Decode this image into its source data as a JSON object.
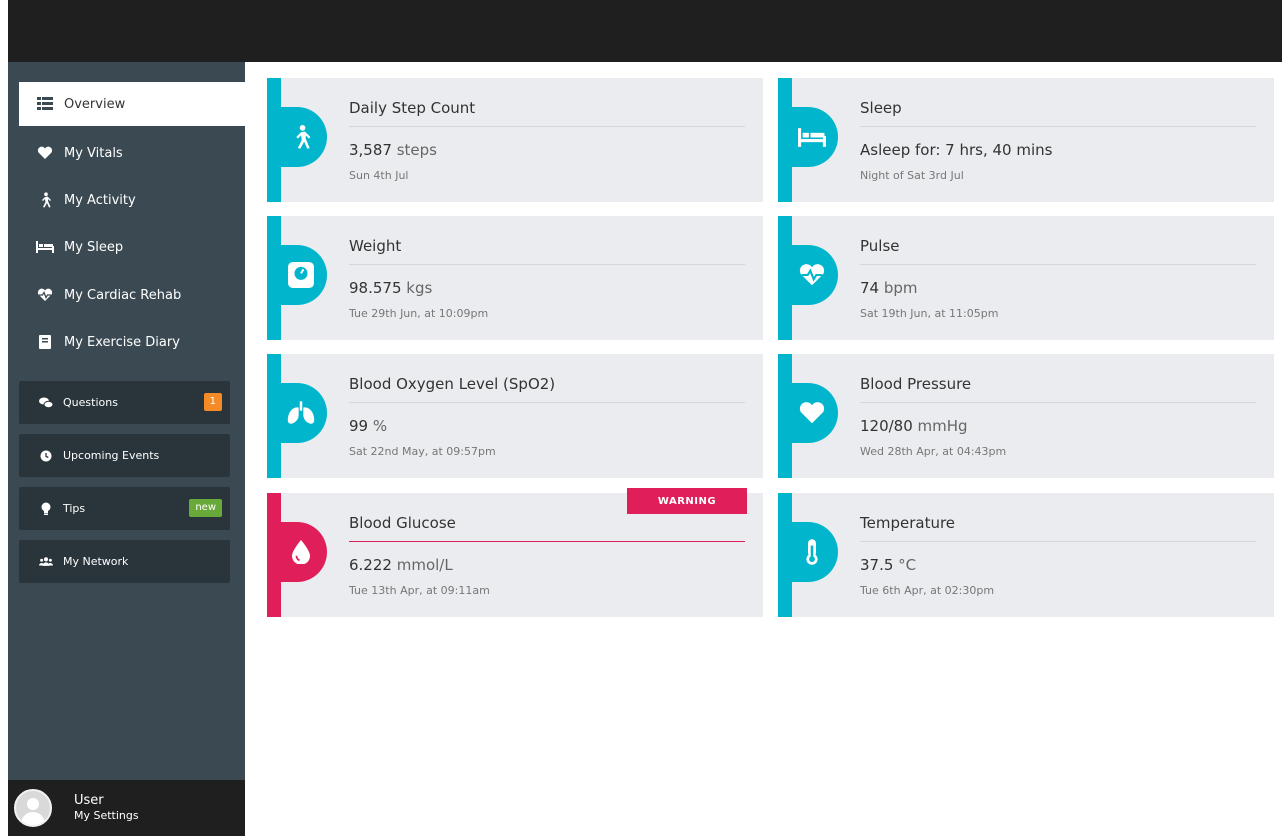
{
  "sidebar": {
    "nav": [
      {
        "label": "Overview",
        "icon": "list-icon"
      },
      {
        "label": "My Vitals",
        "icon": "heart-icon"
      },
      {
        "label": "My Activity",
        "icon": "walking-icon"
      },
      {
        "label": "My Sleep",
        "icon": "bed-icon"
      },
      {
        "label": "My Cardiac Rehab",
        "icon": "heartbeat-icon"
      },
      {
        "label": "My Exercise Diary",
        "icon": "book-icon"
      }
    ],
    "boxes": [
      {
        "label": "Questions",
        "icon": "chat-icon",
        "badge": "1"
      },
      {
        "label": "Upcoming Events",
        "icon": "clock-icon"
      },
      {
        "label": "Tips",
        "icon": "lightbulb-icon",
        "badge": "new"
      },
      {
        "label": "My Network",
        "icon": "users-icon"
      }
    ]
  },
  "user": {
    "name": "User",
    "settings": "My Settings"
  },
  "cards": [
    {
      "title": "Daily Step Count",
      "value": "3,587",
      "unit": " steps",
      "date": "Sun 4th Jul",
      "icon": "walking-icon"
    },
    {
      "title": "Sleep",
      "value": "Asleep for: 7 hrs, 40 mins",
      "unit": "",
      "date": "Night of Sat 3rd Jul",
      "icon": "bed-icon"
    },
    {
      "title": "Weight",
      "value": "98.575",
      "unit": " kgs",
      "date": "Tue 29th Jun, at 10:09pm",
      "icon": "scale-icon"
    },
    {
      "title": "Pulse",
      "value": "74",
      "unit": " bpm",
      "date": "Sat 19th Jun, at 11:05pm",
      "icon": "heartbeat-icon"
    },
    {
      "title": "Blood Oxygen Level (SpO2)",
      "value": "99",
      "unit": " %",
      "date": "Sat 22nd May, at 09:57pm",
      "icon": "lungs-icon"
    },
    {
      "title": "Blood Pressure",
      "value": "120/80",
      "unit": " mmHg",
      "date": "Wed 28th Apr, at 04:43pm",
      "icon": "heart-icon"
    },
    {
      "title": "Blood Glucose",
      "value": "6.222",
      "unit": " mmol/L",
      "date": "Tue 13th Apr, at 09:11am",
      "icon": "droplet-icon",
      "warning": "WARNING"
    },
    {
      "title": "Temperature",
      "value": "37.5",
      "unit": " °C",
      "date": "Tue 6th Apr, at 02:30pm",
      "icon": "thermometer-icon"
    }
  ],
  "colors": {
    "accent": "#00b5cc",
    "warning": "#e01e5a",
    "sidebar": "#3b4a52",
    "topbar": "#1f1f1f"
  }
}
